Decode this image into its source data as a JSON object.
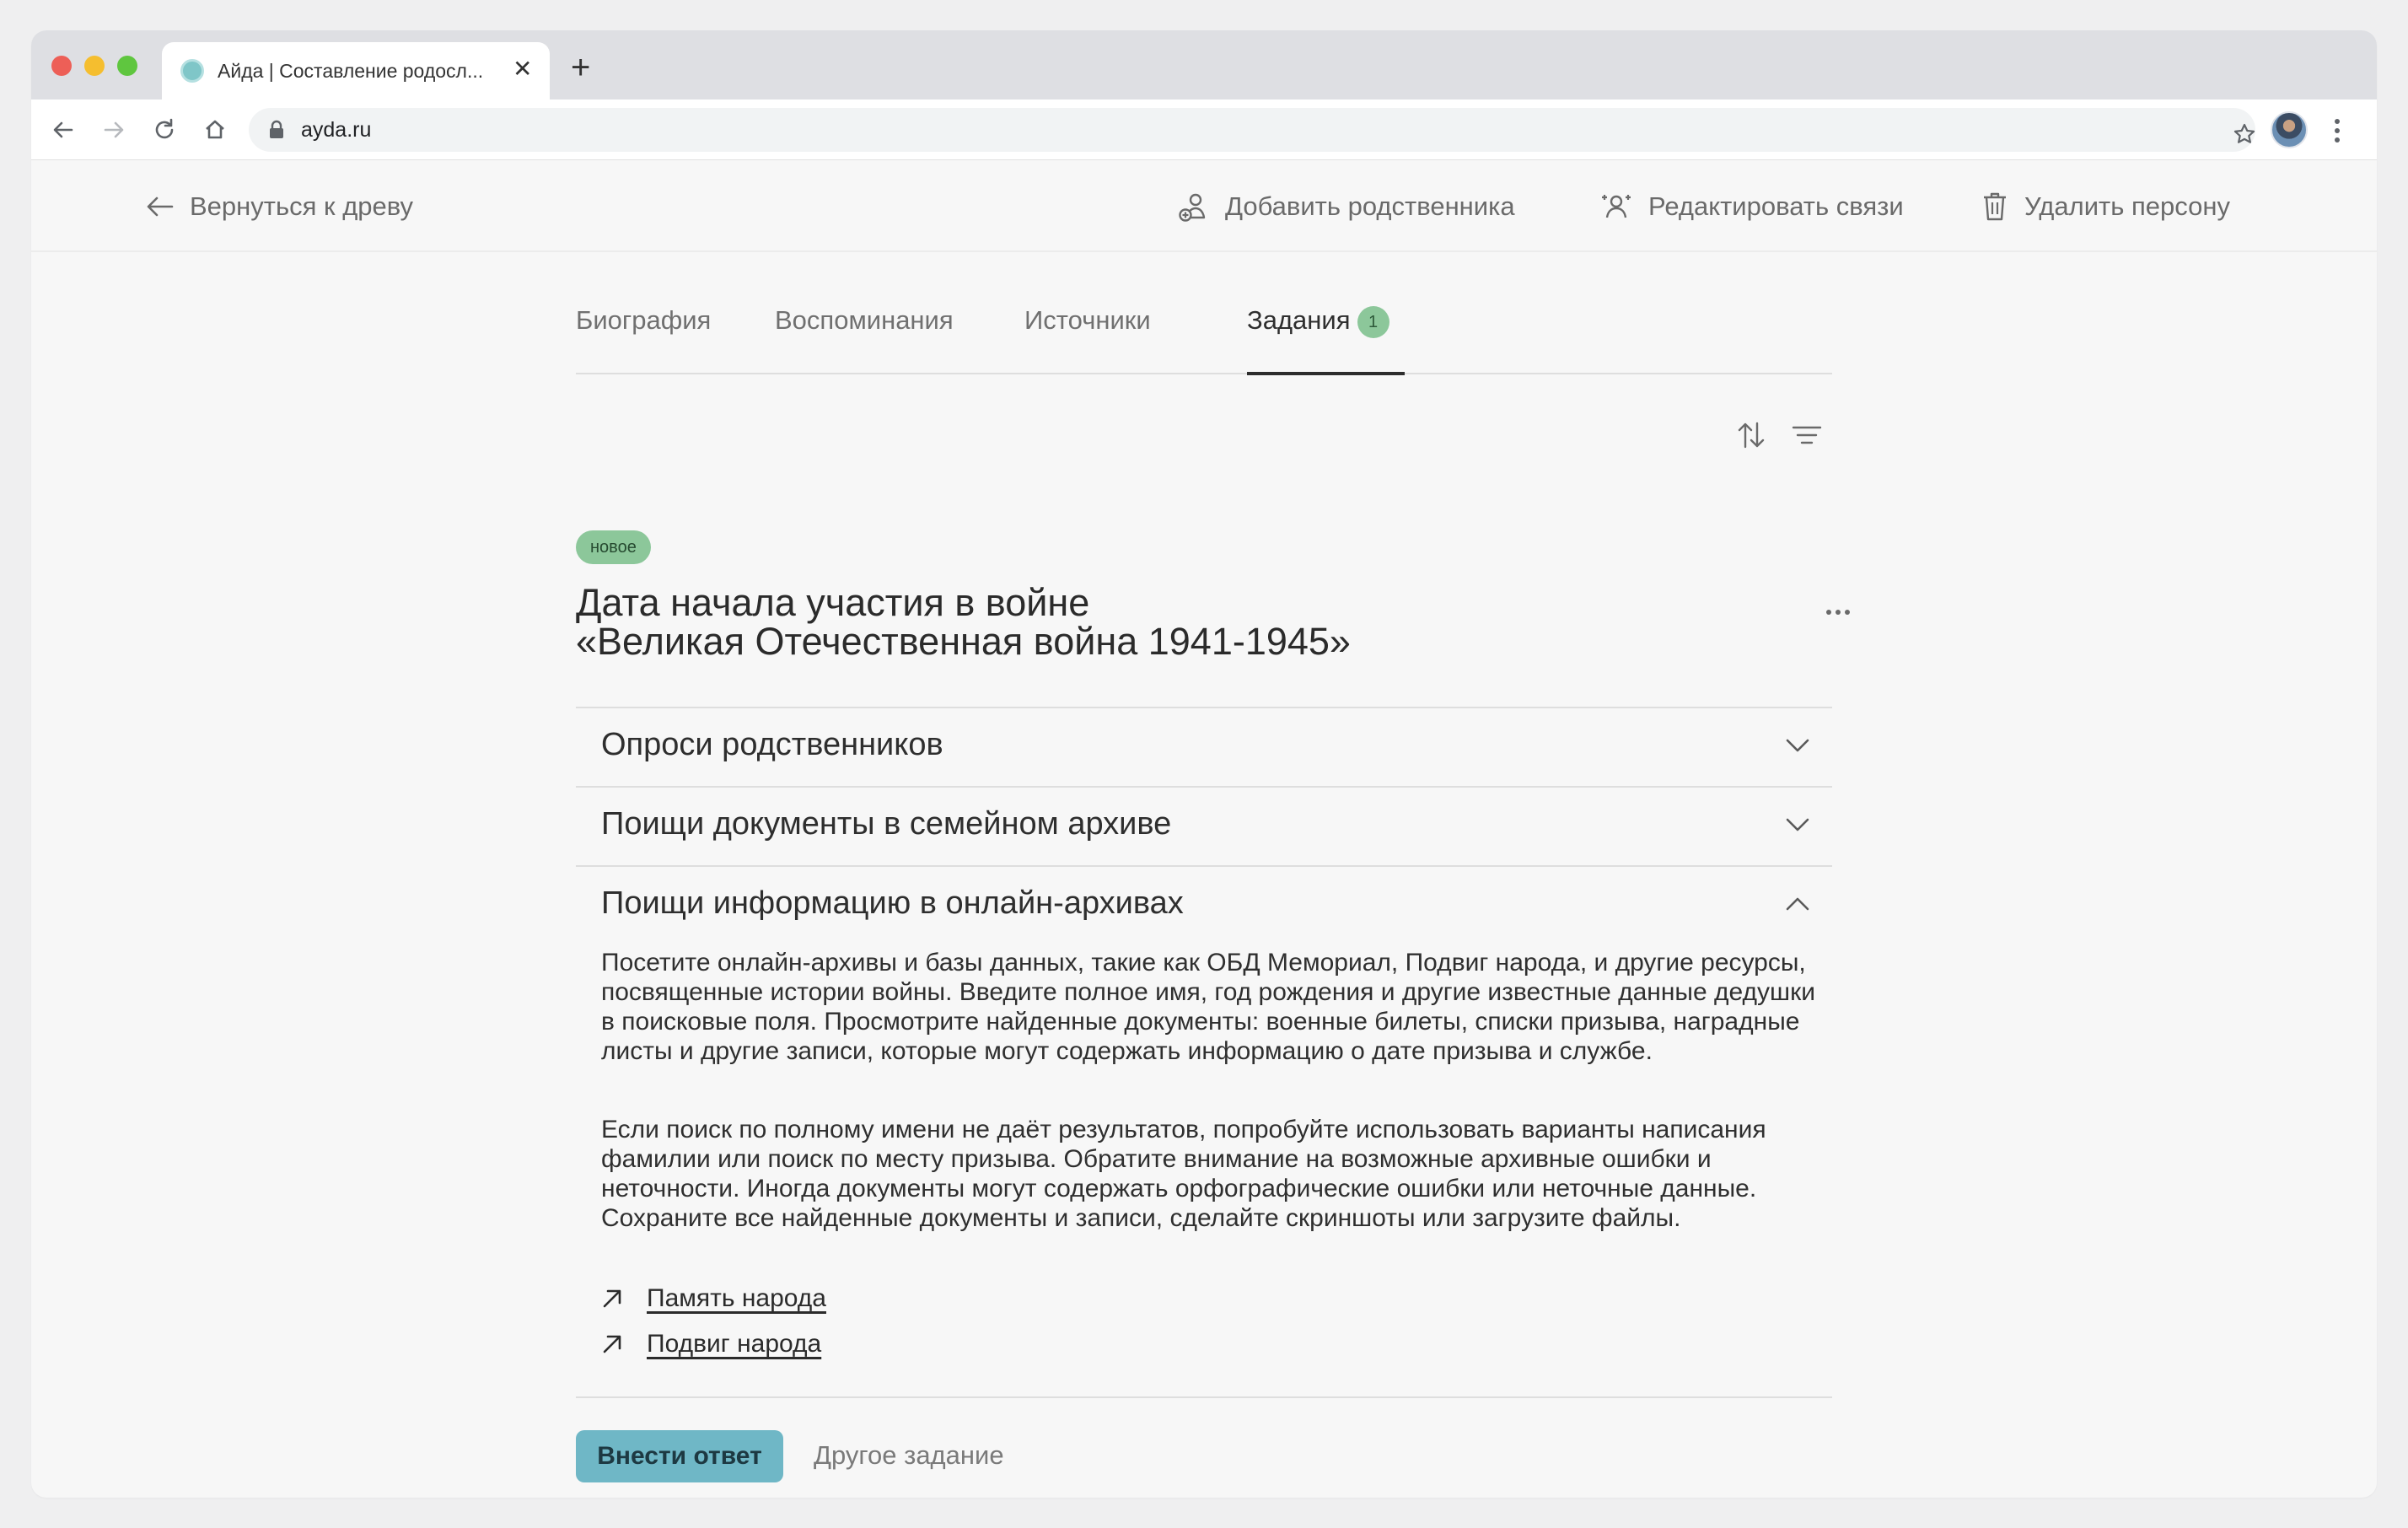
{
  "browser": {
    "tab_title": "Айда | Составление родосл...",
    "tab_close": "✕",
    "new_tab": "+",
    "url": "ayda.ru"
  },
  "header": {
    "back_label": "Вернуться к древу",
    "add_relative": "Добавить родственника",
    "edit_links": "Редактировать связи",
    "delete_person": "Удалить персону"
  },
  "tabs": [
    {
      "label": "Биография",
      "active": false
    },
    {
      "label": "Воспоминания",
      "active": false
    },
    {
      "label": "Источники",
      "active": false
    },
    {
      "label": "Задания",
      "active": true,
      "badge": "1"
    }
  ],
  "task": {
    "status": "новое",
    "title_line1": "Дата начала участия в войне",
    "title_line2": "«Великая Отечественная война 1941-1945»"
  },
  "accordion": [
    {
      "title": "Опроси родственников",
      "expanded": false
    },
    {
      "title": "Поищи документы в семейном архиве",
      "expanded": false
    },
    {
      "title": "Поищи информацию в онлайн-архивах",
      "expanded": true,
      "paragraphs": [
        "Посетите онлайн-архивы и базы данных, такие как ОБД Мемориал, Подвиг народа, и другие ресурсы, посвященные истории войны. Введите полное имя, год рождения и другие известные данные дедушки в поисковые поля. Просмотрите найденные документы: военные билеты, списки призыва, наградные листы и другие записи, которые могут содержать информацию о дате призыва и службе.",
        "Если поиск по полному имени не даёт результатов, попробуйте использовать варианты написания фамилии или поиск по месту призыва. Обратите внимание на возможные архивные ошибки и неточности. Иногда документы могут содержать орфографические ошибки или неточные данные. Сохраните все найденные документы и записи, сделайте скриншоты или загрузите файлы."
      ],
      "links": [
        "Память народа",
        "Подвиг народа"
      ]
    }
  ],
  "actions": {
    "submit": "Внести ответ",
    "other": "Другое задание"
  },
  "colors": {
    "accent": "#6fb7c6",
    "badge_green": "#8cc79a"
  }
}
